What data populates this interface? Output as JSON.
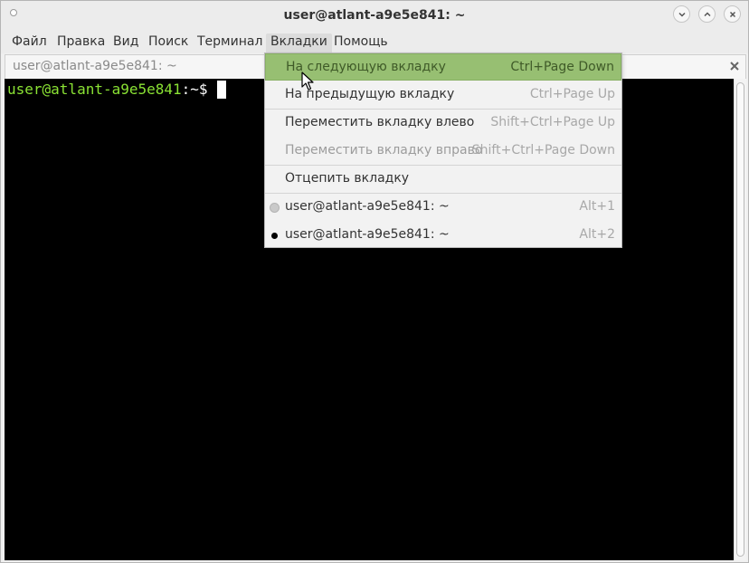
{
  "window": {
    "title": "user@atlant-a9e5e841: ~"
  },
  "menubar": {
    "items": [
      {
        "label": "Файл"
      },
      {
        "label": "Правка"
      },
      {
        "label": "Вид"
      },
      {
        "label": "Поиск"
      },
      {
        "label": "Терминал"
      },
      {
        "label": "Вкладки"
      },
      {
        "label": "Помощь"
      }
    ]
  },
  "tab": {
    "label": "user@atlant-a9e5e841: ~"
  },
  "terminal": {
    "prompt_user": "user@atlant-a9e5e841",
    "prompt_rest": ":~$"
  },
  "tabs_menu": {
    "items": [
      {
        "label": "На следующую вкладку",
        "shortcut": "Ctrl+Page Down"
      },
      {
        "label": "На предыдущую вкладку",
        "shortcut": "Ctrl+Page Up"
      },
      {
        "label": "Переместить вкладку влево",
        "shortcut": "Shift+Ctrl+Page Up"
      },
      {
        "label": "Переместить вкладку вправо",
        "shortcut": "Shift+Ctrl+Page Down"
      },
      {
        "label": "Отцепить вкладку",
        "shortcut": ""
      },
      {
        "label": "user@atlant-a9e5e841: ~",
        "shortcut": "Alt+1"
      },
      {
        "label": "user@atlant-a9e5e841: ~",
        "shortcut": "Alt+2"
      }
    ]
  },
  "colors": {
    "highlight": "#97bf72",
    "prompt_green": "#8ae234",
    "terminal_bg": "#000000"
  }
}
